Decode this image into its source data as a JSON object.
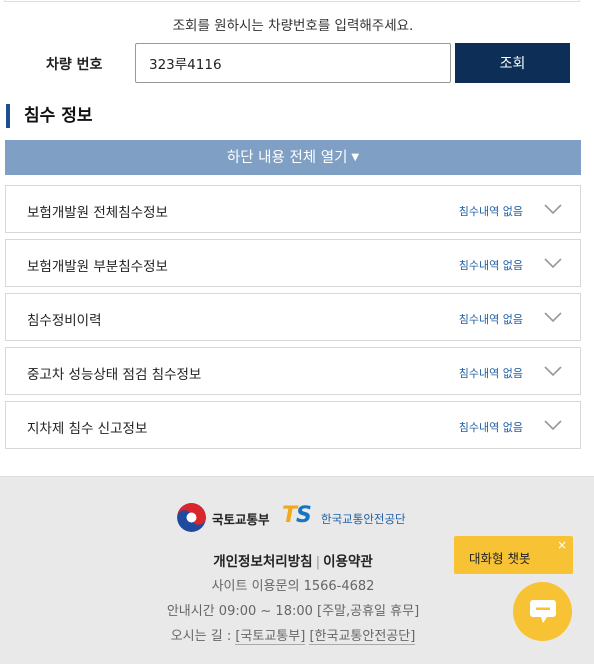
{
  "search": {
    "instruction": "조회를 원하시는 차량번호를 입력해주세요.",
    "label": "차량 번호",
    "value": "323루4116",
    "button_label": "조회"
  },
  "section": {
    "title": "침수 정보",
    "expand_label": "하단 내용 전체 열기",
    "items": [
      {
        "title": "보험개발원 전체침수정보",
        "status": "침수내역 없음"
      },
      {
        "title": "보험개발원 부분침수정보",
        "status": "침수내역 없음"
      },
      {
        "title": "침수정비이력",
        "status": "침수내역 없음"
      },
      {
        "title": "중고차 성능상태 점검 침수정보",
        "status": "침수내역 없음"
      },
      {
        "title": "지차제 침수 신고정보",
        "status": "침수내역 없음"
      }
    ]
  },
  "footer": {
    "logo_molit": "국토교통부",
    "logo_ts_mark": "TS",
    "logo_kotsa": "한국교통안전공단",
    "privacy_label": "개인정보처리방침",
    "separator": "|",
    "terms_label": "이용약관",
    "phone_line": "사이트 이용문의 1566-4682",
    "hours_line": "안내시간 09:00 ~ 18:00 [주말,공휴일 휴무]",
    "directions_prefix": "오시는 길 :",
    "directions_molit": "[국토교통부]",
    "directions_kotsa": "[한국교통안전공단]"
  },
  "chatbot": {
    "tooltip_label": "대화형 챗봇",
    "close_glyph": "×"
  },
  "colors": {
    "primary_navy": "#0d2e57",
    "expand_bar": "#7f9fc4",
    "status_blue": "#1f5fa6",
    "chat_yellow": "#f7c335"
  }
}
